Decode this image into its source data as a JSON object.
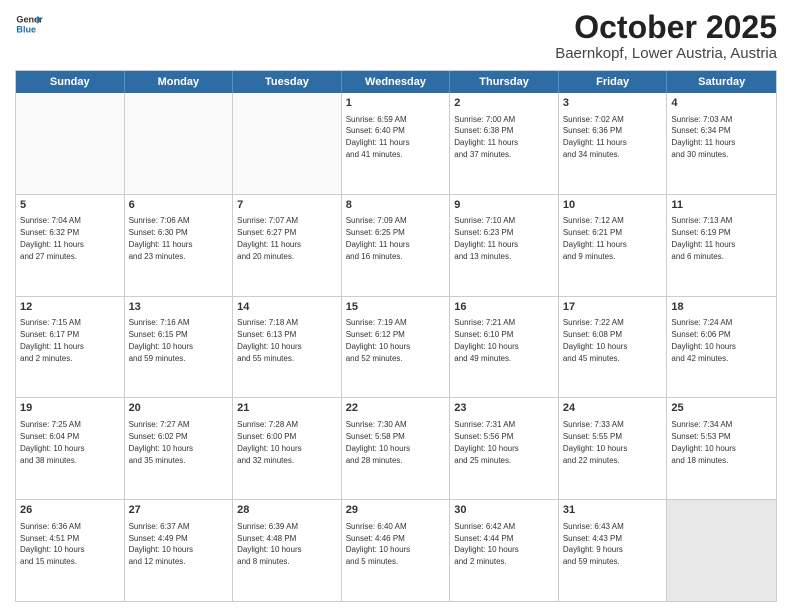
{
  "header": {
    "logo_general": "General",
    "logo_blue": "Blue",
    "month": "October 2025",
    "location": "Baernkopf, Lower Austria, Austria"
  },
  "days_of_week": [
    "Sunday",
    "Monday",
    "Tuesday",
    "Wednesday",
    "Thursday",
    "Friday",
    "Saturday"
  ],
  "weeks": [
    [
      {
        "day": "",
        "text": "",
        "empty": true
      },
      {
        "day": "",
        "text": "",
        "empty": true
      },
      {
        "day": "",
        "text": "",
        "empty": true
      },
      {
        "day": "1",
        "text": "Sunrise: 6:59 AM\nSunset: 6:40 PM\nDaylight: 11 hours\nand 41 minutes."
      },
      {
        "day": "2",
        "text": "Sunrise: 7:00 AM\nSunset: 6:38 PM\nDaylight: 11 hours\nand 37 minutes."
      },
      {
        "day": "3",
        "text": "Sunrise: 7:02 AM\nSunset: 6:36 PM\nDaylight: 11 hours\nand 34 minutes."
      },
      {
        "day": "4",
        "text": "Sunrise: 7:03 AM\nSunset: 6:34 PM\nDaylight: 11 hours\nand 30 minutes."
      }
    ],
    [
      {
        "day": "5",
        "text": "Sunrise: 7:04 AM\nSunset: 6:32 PM\nDaylight: 11 hours\nand 27 minutes."
      },
      {
        "day": "6",
        "text": "Sunrise: 7:06 AM\nSunset: 6:30 PM\nDaylight: 11 hours\nand 23 minutes."
      },
      {
        "day": "7",
        "text": "Sunrise: 7:07 AM\nSunset: 6:27 PM\nDaylight: 11 hours\nand 20 minutes."
      },
      {
        "day": "8",
        "text": "Sunrise: 7:09 AM\nSunset: 6:25 PM\nDaylight: 11 hours\nand 16 minutes."
      },
      {
        "day": "9",
        "text": "Sunrise: 7:10 AM\nSunset: 6:23 PM\nDaylight: 11 hours\nand 13 minutes."
      },
      {
        "day": "10",
        "text": "Sunrise: 7:12 AM\nSunset: 6:21 PM\nDaylight: 11 hours\nand 9 minutes."
      },
      {
        "day": "11",
        "text": "Sunrise: 7:13 AM\nSunset: 6:19 PM\nDaylight: 11 hours\nand 6 minutes."
      }
    ],
    [
      {
        "day": "12",
        "text": "Sunrise: 7:15 AM\nSunset: 6:17 PM\nDaylight: 11 hours\nand 2 minutes."
      },
      {
        "day": "13",
        "text": "Sunrise: 7:16 AM\nSunset: 6:15 PM\nDaylight: 10 hours\nand 59 minutes."
      },
      {
        "day": "14",
        "text": "Sunrise: 7:18 AM\nSunset: 6:13 PM\nDaylight: 10 hours\nand 55 minutes."
      },
      {
        "day": "15",
        "text": "Sunrise: 7:19 AM\nSunset: 6:12 PM\nDaylight: 10 hours\nand 52 minutes."
      },
      {
        "day": "16",
        "text": "Sunrise: 7:21 AM\nSunset: 6:10 PM\nDaylight: 10 hours\nand 49 minutes."
      },
      {
        "day": "17",
        "text": "Sunrise: 7:22 AM\nSunset: 6:08 PM\nDaylight: 10 hours\nand 45 minutes."
      },
      {
        "day": "18",
        "text": "Sunrise: 7:24 AM\nSunset: 6:06 PM\nDaylight: 10 hours\nand 42 minutes."
      }
    ],
    [
      {
        "day": "19",
        "text": "Sunrise: 7:25 AM\nSunset: 6:04 PM\nDaylight: 10 hours\nand 38 minutes."
      },
      {
        "day": "20",
        "text": "Sunrise: 7:27 AM\nSunset: 6:02 PM\nDaylight: 10 hours\nand 35 minutes."
      },
      {
        "day": "21",
        "text": "Sunrise: 7:28 AM\nSunset: 6:00 PM\nDaylight: 10 hours\nand 32 minutes."
      },
      {
        "day": "22",
        "text": "Sunrise: 7:30 AM\nSunset: 5:58 PM\nDaylight: 10 hours\nand 28 minutes."
      },
      {
        "day": "23",
        "text": "Sunrise: 7:31 AM\nSunset: 5:56 PM\nDaylight: 10 hours\nand 25 minutes."
      },
      {
        "day": "24",
        "text": "Sunrise: 7:33 AM\nSunset: 5:55 PM\nDaylight: 10 hours\nand 22 minutes."
      },
      {
        "day": "25",
        "text": "Sunrise: 7:34 AM\nSunset: 5:53 PM\nDaylight: 10 hours\nand 18 minutes."
      }
    ],
    [
      {
        "day": "26",
        "text": "Sunrise: 6:36 AM\nSunset: 4:51 PM\nDaylight: 10 hours\nand 15 minutes."
      },
      {
        "day": "27",
        "text": "Sunrise: 6:37 AM\nSunset: 4:49 PM\nDaylight: 10 hours\nand 12 minutes."
      },
      {
        "day": "28",
        "text": "Sunrise: 6:39 AM\nSunset: 4:48 PM\nDaylight: 10 hours\nand 8 minutes."
      },
      {
        "day": "29",
        "text": "Sunrise: 6:40 AM\nSunset: 4:46 PM\nDaylight: 10 hours\nand 5 minutes."
      },
      {
        "day": "30",
        "text": "Sunrise: 6:42 AM\nSunset: 4:44 PM\nDaylight: 10 hours\nand 2 minutes."
      },
      {
        "day": "31",
        "text": "Sunrise: 6:43 AM\nSunset: 4:43 PM\nDaylight: 9 hours\nand 59 minutes."
      },
      {
        "day": "",
        "text": "",
        "empty": true,
        "shaded": true
      }
    ]
  ]
}
